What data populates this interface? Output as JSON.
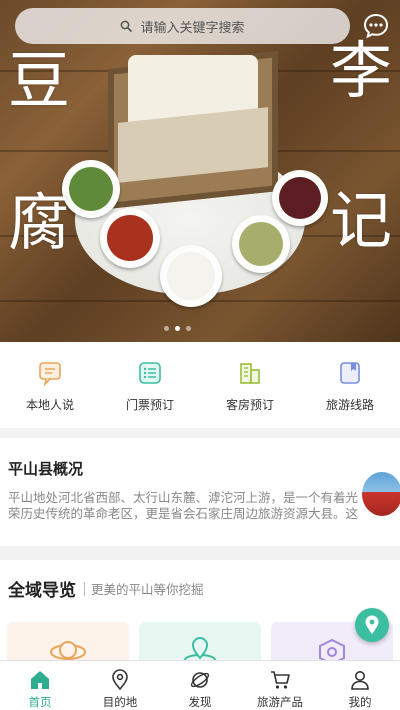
{
  "banner": {
    "left_title": [
      "豆",
      "腐"
    ],
    "right_title": [
      "李",
      "记"
    ],
    "slides": 3,
    "active_slide": 1
  },
  "search": {
    "placeholder": "请输入关键字搜索"
  },
  "quick_menu": [
    {
      "label": "本地人说",
      "icon": "chat-bubble-icon",
      "color": "#e8a45a"
    },
    {
      "label": "门票预订",
      "icon": "ticket-list-icon",
      "color": "#3bbfa0"
    },
    {
      "label": "客房预订",
      "icon": "hotel-building-icon",
      "color": "#9bbf3a"
    },
    {
      "label": "旅游线路",
      "icon": "route-book-icon",
      "color": "#7a8ee0"
    }
  ],
  "overview": {
    "title": "平山县概况",
    "description": "平山地处河北省西部、太行山东麓、滹沱河上游，是一个有着光荣历史传统的革命老区，更是省会石家庄周边旅游资源大县。这里汇..."
  },
  "guide": {
    "title": "全域导览",
    "subtitle": "更美的平山等你挖掘"
  },
  "tabbar": [
    {
      "label": "首页",
      "icon": "home-icon",
      "active": true
    },
    {
      "label": "目的地",
      "icon": "location-pin-icon",
      "active": false
    },
    {
      "label": "发现",
      "icon": "planet-icon",
      "active": false
    },
    {
      "label": "旅游产品",
      "icon": "shopping-cart-icon",
      "active": false
    },
    {
      "label": "我的",
      "icon": "user-icon",
      "active": false
    }
  ],
  "colors": {
    "accent": "#2fae8f",
    "fab": "#3bbfa0"
  }
}
